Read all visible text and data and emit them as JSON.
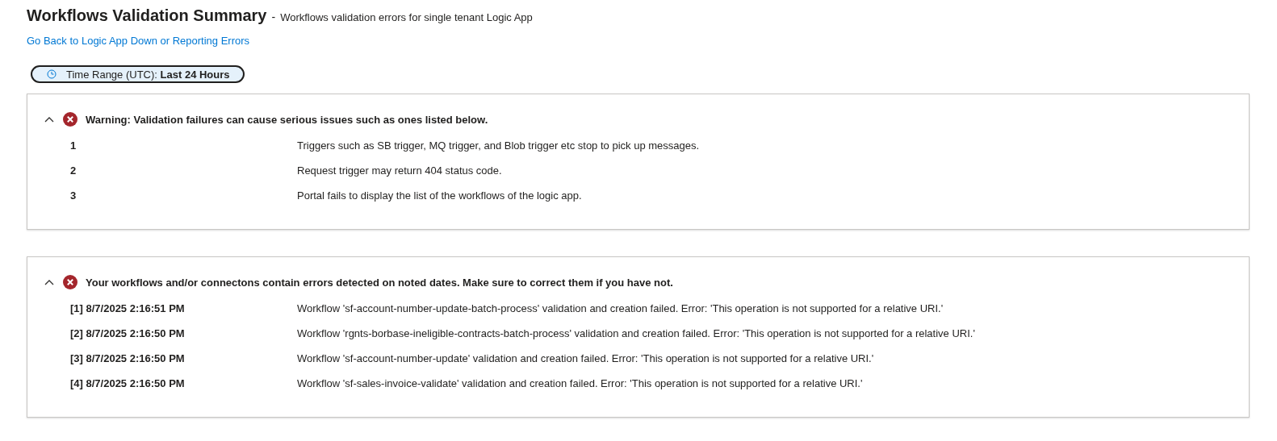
{
  "header": {
    "title": "Workflows Validation Summary",
    "separator": "-",
    "subtitle": "Workflows validation errors for single tenant Logic App",
    "back_link": "Go Back to Logic App Down or Reporting Errors"
  },
  "time_range": {
    "label": "Time Range (UTC):",
    "value": "Last 24 Hours"
  },
  "sections": [
    {
      "expanded": true,
      "kind": "error",
      "message": "Warning: Validation failures can cause serious issues such as ones listed below.",
      "rows": [
        {
          "key": "1",
          "value": "Triggers such as SB trigger, MQ trigger, and Blob trigger etc stop to pick up messages."
        },
        {
          "key": "2",
          "value": "Request trigger may return 404 status code."
        },
        {
          "key": "3",
          "value": "Portal fails to display the list of the workflows of the logic app."
        }
      ]
    },
    {
      "expanded": true,
      "kind": "error",
      "message": "Your workflows and/or connectons contain errors detected on noted dates. Make sure to correct them if you have not.",
      "rows": [
        {
          "key": "[1] 8/7/2025 2:16:51 PM",
          "value": "Workflow 'sf-account-number-update-batch-process' validation and creation failed. Error: 'This operation is not supported for a relative URI.'"
        },
        {
          "key": "[2] 8/7/2025 2:16:50 PM",
          "value": "Workflow 'rgnts-borbase-ineligible-contracts-batch-process' validation and creation failed. Error: 'This operation is not supported for a relative URI.'"
        },
        {
          "key": "[3] 8/7/2025 2:16:50 PM",
          "value": "Workflow 'sf-account-number-update' validation and creation failed. Error: 'This operation is not supported for a relative URI.'"
        },
        {
          "key": "[4] 8/7/2025 2:16:50 PM",
          "value": "Workflow 'sf-sales-invoice-validate' validation and creation failed. Error: 'This operation is not supported for a relative URI.'"
        }
      ]
    }
  ]
}
